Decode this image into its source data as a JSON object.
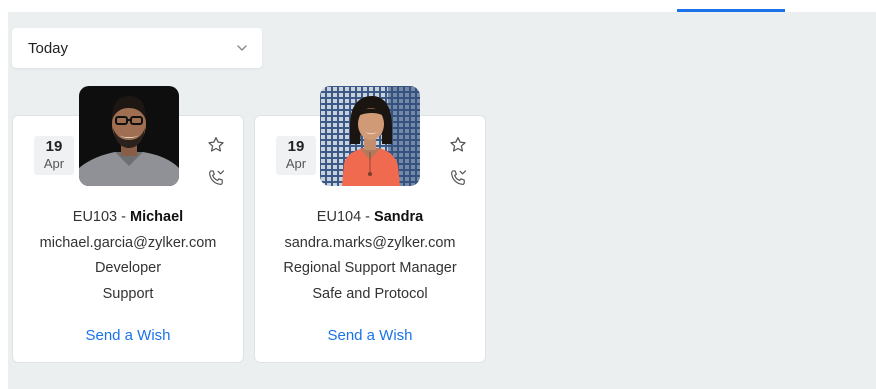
{
  "filter": {
    "selected": "Today"
  },
  "cards": [
    {
      "day": "19",
      "month": "Apr",
      "emp_id": "EU103",
      "separator": " - ",
      "name": "Michael",
      "email": "michael.garcia@zylker.com",
      "designation": "Developer",
      "department": "Support",
      "action": "Send a Wish"
    },
    {
      "day": "19",
      "month": "Apr",
      "emp_id": "EU104",
      "separator": " - ",
      "name": "Sandra",
      "email": "sandra.marks@zylker.com",
      "designation": "Regional Support Manager",
      "department": "Safe and Protocol",
      "action": "Send a Wish"
    }
  ],
  "colors": {
    "accent": "#1a73e8",
    "background": "#ebeff0"
  },
  "icons": [
    "chevron-down-icon",
    "star-icon",
    "phone-missed-icon"
  ]
}
